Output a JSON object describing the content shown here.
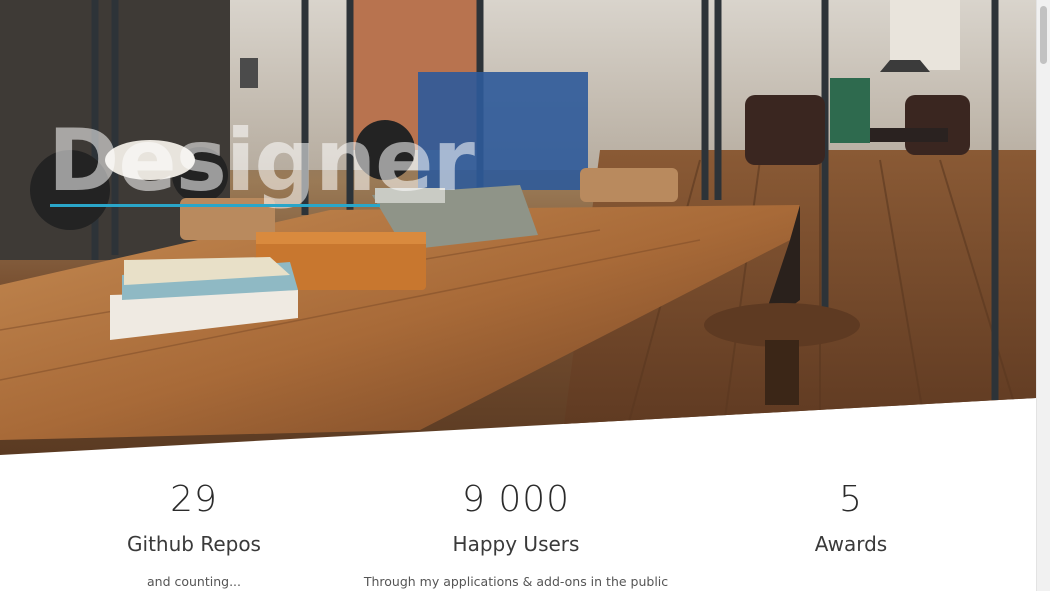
{
  "hero": {
    "title": "Designer"
  },
  "stats": [
    {
      "value": "29",
      "label": "Github Repos",
      "description": "and counting..."
    },
    {
      "value": "9 000",
      "label": "Happy Users",
      "description": "Through my applications & add-ons in the public"
    },
    {
      "value": "5",
      "label": "Awards",
      "description": ""
    }
  ],
  "colors": {
    "accent": "#2aa6c9",
    "text_dark": "#2b2b2b"
  }
}
